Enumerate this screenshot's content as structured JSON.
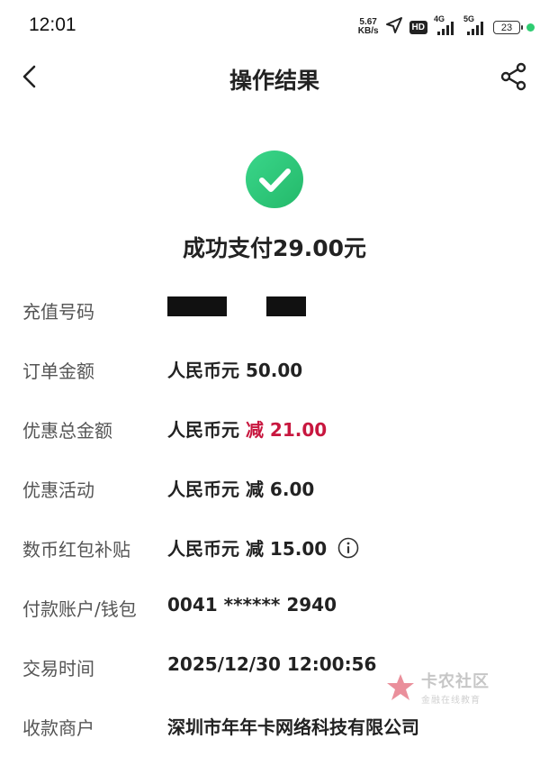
{
  "status_bar": {
    "time": "12:01",
    "net_speed_value": "5.67",
    "net_speed_unit": "KB/s",
    "hd_label": "HD",
    "signal_1_label": "4G",
    "signal_2_label": "5G",
    "battery_level": "23",
    "dot_color": "#2ecc71"
  },
  "nav": {
    "title": "操作结果"
  },
  "result": {
    "message": "成功支付29.00元",
    "icon_color": "#2ecc71"
  },
  "rows": [
    {
      "label": "充值号码",
      "value": ""
    },
    {
      "label": "订单金额",
      "value": "人民币元 50.00"
    },
    {
      "label": "优惠总金额",
      "value_prefix": "人民币元 ",
      "value_highlight": "减 21.00",
      "highlight_color": "#c8173f"
    },
    {
      "label": "优惠活动",
      "value": "人民币元 减 6.00"
    },
    {
      "label": "数币红包补贴",
      "value": "人民币元 减 15.00"
    },
    {
      "label": "付款账户/钱包",
      "value": "0041 ****** 2940"
    },
    {
      "label": "交易时间",
      "value": "2025/12/30 12:00:56"
    },
    {
      "label": "收款商户",
      "value": "深圳市年年卡网络科技有限公司"
    }
  ],
  "watermark": {
    "title": "卡农社区",
    "subtitle": "金融在线教育"
  }
}
